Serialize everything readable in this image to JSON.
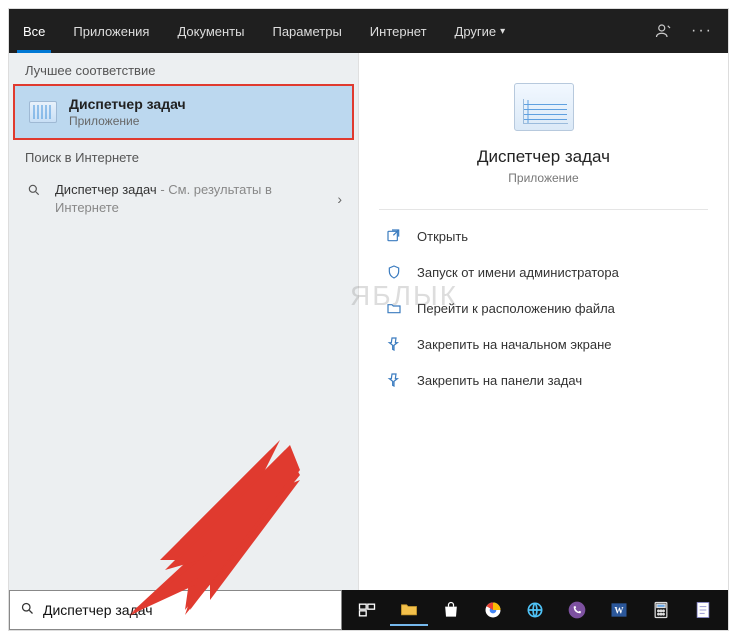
{
  "tabs": {
    "all": "Все",
    "apps": "Приложения",
    "documents": "Документы",
    "settings": "Параметры",
    "internet": "Интернет",
    "more": "Другие"
  },
  "left": {
    "best_match_label": "Лучшее соответствие",
    "result": {
      "title": "Диспетчер задач",
      "subtitle": "Приложение"
    },
    "web_label": "Поиск в Интернете",
    "web_result": {
      "term": "Диспетчер задач",
      "suffix": " - См. результаты в Интернете"
    }
  },
  "right": {
    "name": "Диспетчер задач",
    "type": "Приложение",
    "actions": {
      "open": "Открыть",
      "run_admin": "Запуск от имени администратора",
      "open_location": "Перейти к расположению файла",
      "pin_start": "Закрепить на начальном экране",
      "pin_taskbar": "Закрепить на панели задач"
    }
  },
  "taskbar": {
    "search_value": "Диспетчер задач"
  },
  "watermark": "ЯБЛЫК"
}
